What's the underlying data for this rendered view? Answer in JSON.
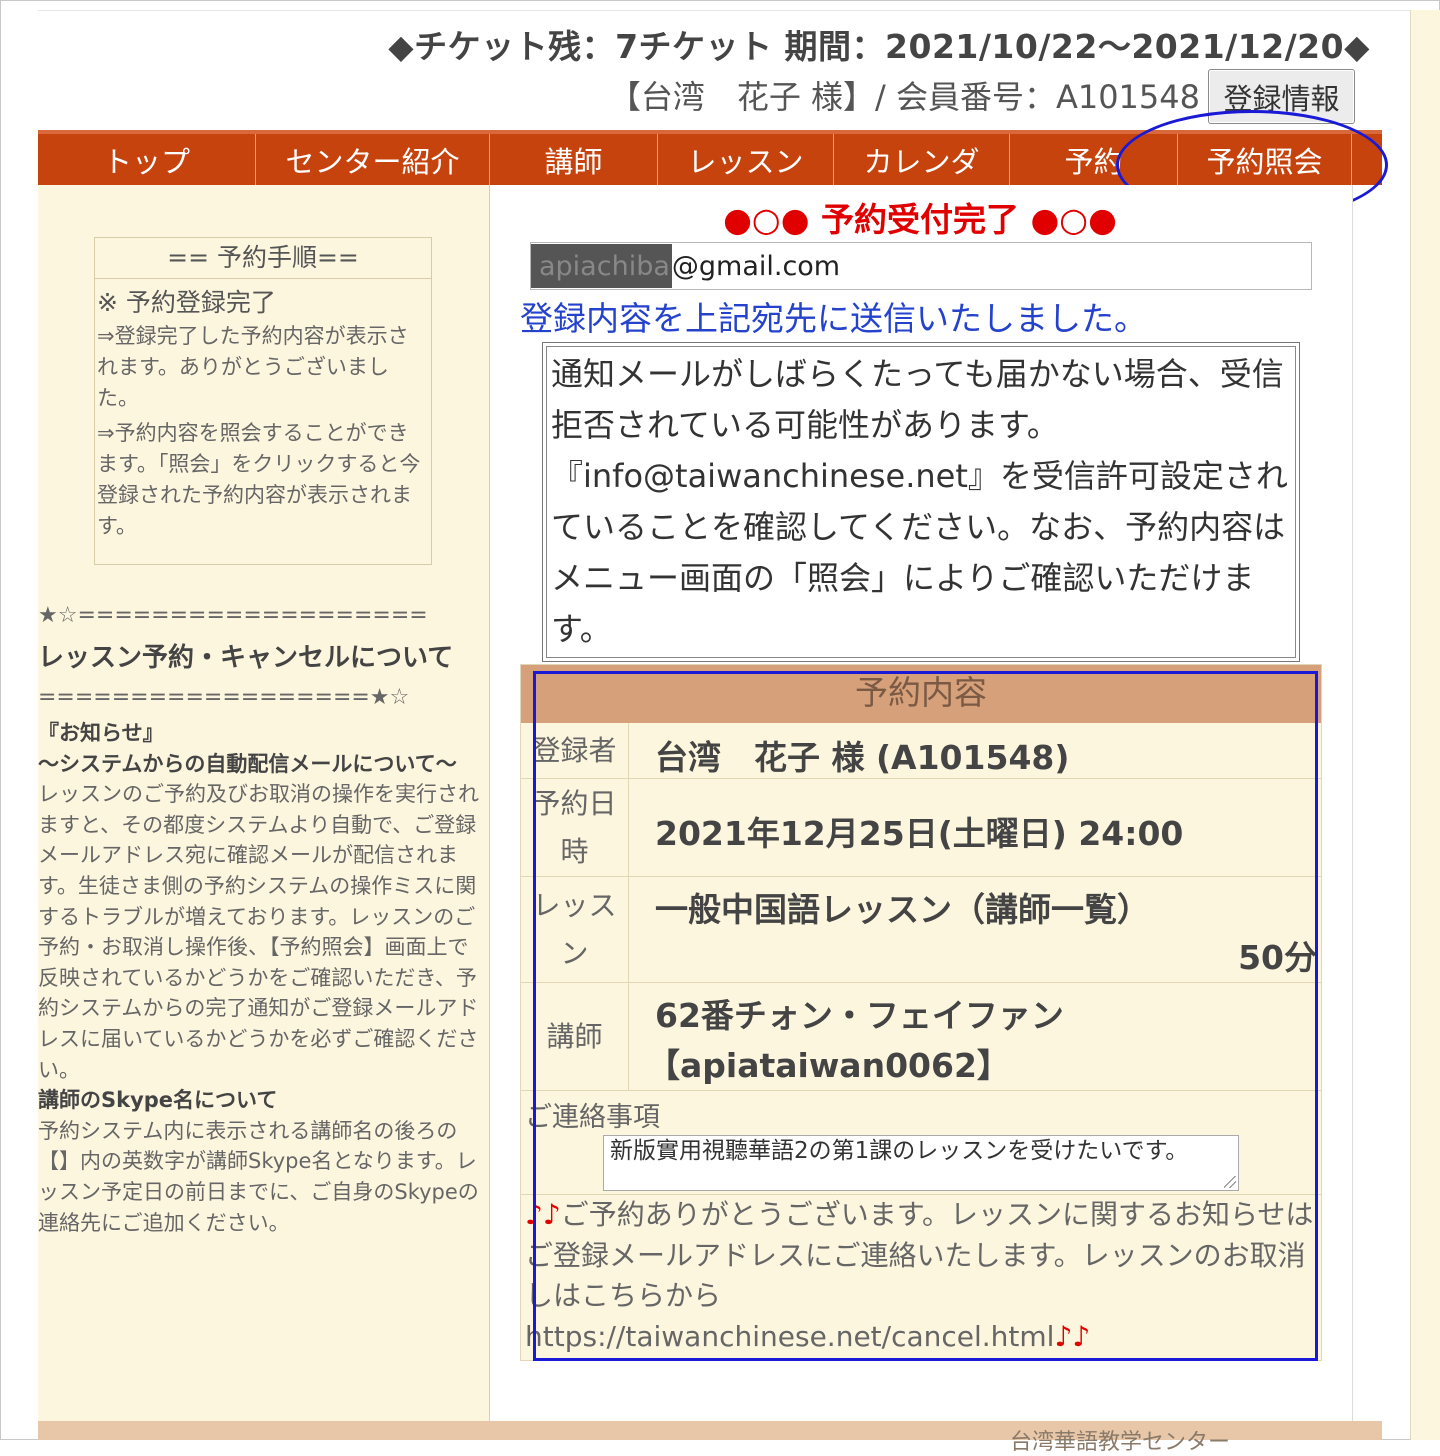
{
  "header": {
    "ticket_line": "◆チケット残：7チケット 期間：2021/10/22～2021/12/20◆",
    "member_line": "【台湾　花子 様】/ 会員番号：A101548",
    "register_button": "登録情報"
  },
  "nav": {
    "items": [
      {
        "label": "トップ"
      },
      {
        "label": "センター紹介"
      },
      {
        "label": "講師"
      },
      {
        "label": "レッスン"
      },
      {
        "label": "カレンダ"
      },
      {
        "label": "予約"
      },
      {
        "label": "予約照会"
      }
    ]
  },
  "sidebar": {
    "steps_title": "== 予約手順==",
    "steps_sub": "※ 予約登録完了",
    "steps_text_1": "⇒登録完了した予約内容が表示されます。ありがとうございました。",
    "steps_text_2": "⇒予約内容を照会することができます。「照会」をクリックすると今登録された予約内容が表示されます。",
    "separator_top": "★☆===================",
    "heading": "レッスン予約・キャンセルについて",
    "separator_bottom": "==================★☆",
    "notice_title": "『お知らせ』",
    "notice_subtitle": "～システムからの自動配信メールについて～",
    "notice_body": "レッスンのご予約及びお取消の操作を実行されますと、その都度システムより自動で、ご登録メールアドレス宛に確認メールが配信されます。生徒さま側の予約システムの操作ミスに関するトラブルが増えております。レッスンのご予約・お取消し操作後、【予約照会】画面上で反映されているかどうかをご確認いただき、予約システムからの完了通知がご登録メールアドレスに届いているかどうかを必ずご確認ください。",
    "skype_title": "講師のSkype名について",
    "skype_body": "予約システム内に表示される講師名の後ろの【】内の英数字が講師Skype名となります。レッスン予定日の前日までに、ご自身のSkypeの連絡先にご追加ください。"
  },
  "main": {
    "completion_title": "●○● 予約受付完了 ●○●",
    "email_masked": "apiachiba",
    "email_domain": "@gmail.com",
    "sent_message": "登録内容を上記宛先に送信いたしました。",
    "warning": "通知メールがしばらくたっても届かない場合、受信拒否されている可能性があります。『info@taiwanchinese.net』を受信許可設定されていることを確認してください。なお、予約内容はメニュー画面の「照会」によりご確認いただけます。",
    "table": {
      "heading": "予約内容",
      "registrant_label": "登録者",
      "registrant_value": "台湾　花子 様 (A101548)",
      "datetime_label": "予約日時",
      "datetime_value": "2021年12月25日(土曜日) 24:00",
      "lesson_label": "レッスン",
      "lesson_value": "一般中国語レッスン（講師一覧）",
      "lesson_duration": "50分",
      "teacher_label": "講師",
      "teacher_name": "62番チォン・フェイファン",
      "teacher_skype": "【apiataiwan0062】",
      "contact_label": "ご連絡事項",
      "contact_value": "新版實用視聽華語2の第1課のレッスンを受けたいです。",
      "thanks_prefix": "♪♪",
      "thanks_text": "ご予約ありがとうございます。レッスンに関するお知らせはご登録メールアドレスにご連絡いたします。レッスンのお取消しはこちらから",
      "cancel_url": "https://taiwanchinese.net/cancel.html",
      "thanks_suffix": "♪♪"
    }
  },
  "footer": {
    "text": "台湾華語教学センター"
  },
  "colors": {
    "nav_bg": "#c7430e",
    "sidebar_bg": "#fdf6df",
    "table_head_bg": "#d6a07a",
    "alert_red": "#e00000",
    "link_blue": "#2442cc",
    "annotation_blue": "#1a1ad6"
  }
}
